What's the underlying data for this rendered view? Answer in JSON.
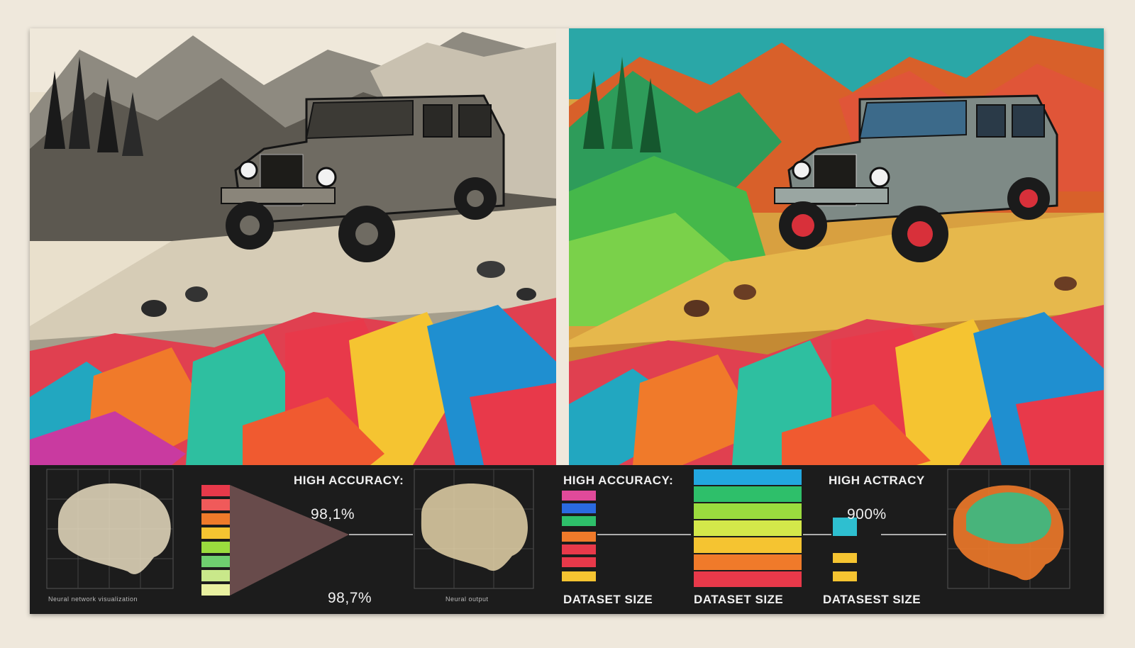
{
  "left_panel": {
    "label_high_accuracy": "HIGH ACCURACY:",
    "accuracy_value_top": "98,1%",
    "accuracy_value_bottom": "98,7%",
    "caption_left": "Neural network visualization",
    "caption_right": "Neural output"
  },
  "right_panel": {
    "label_high_accuracy": "HIGH ACCURACY:",
    "label_high_actracy": "HIGH ACTRACY",
    "accuracy_value": "900%",
    "dataset_labels": [
      "DATASET SIZE",
      "DATASET SIZE",
      "DATASEST SIZE"
    ]
  },
  "colors": {
    "background": "#efe8dc",
    "strip": "#1c1c1c",
    "bars": [
      "#e8394a",
      "#f07a2a",
      "#f5c431",
      "#9bdc3e",
      "#2ebf6a",
      "#22a7e0"
    ]
  }
}
